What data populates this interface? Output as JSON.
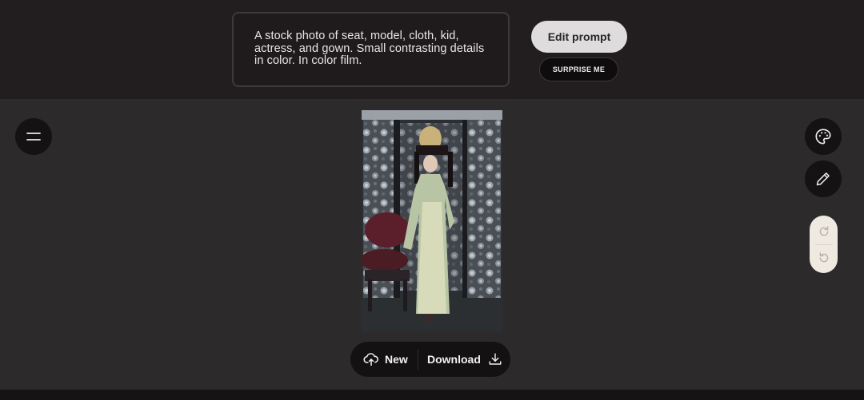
{
  "prompt": {
    "text": "A stock photo of  seat, model, cloth, kid, actress, and gown. Small contrasting details in color. In color film."
  },
  "buttons": {
    "edit_prompt": "Edit prompt",
    "surprise_me": "SURPRISE ME"
  },
  "sidebar_right": {
    "icons": [
      "palette-icon",
      "pencil-icon",
      "redo-icon",
      "undo-icon"
    ]
  },
  "left_menu": {
    "icon": "menu-icon"
  },
  "actions": {
    "new_label": "New",
    "download_label": "Download"
  },
  "colors": {
    "background": "#2c2a2b",
    "topbar": "#221e1f",
    "button_light": "#dedcdc",
    "button_dark": "#141213",
    "history_pill": "#efeae1"
  }
}
